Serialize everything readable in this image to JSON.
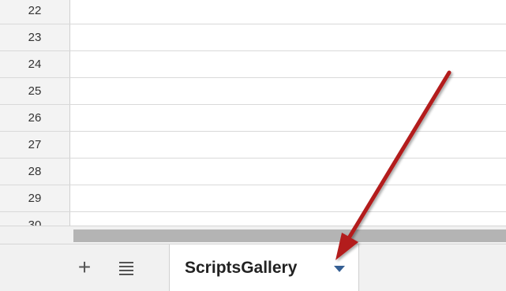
{
  "grid": {
    "rows": [
      {
        "number": "22"
      },
      {
        "number": "23"
      },
      {
        "number": "24"
      },
      {
        "number": "25"
      },
      {
        "number": "26"
      },
      {
        "number": "27"
      },
      {
        "number": "28"
      },
      {
        "number": "29"
      },
      {
        "number": "30"
      }
    ]
  },
  "sheet_bar": {
    "add_sheet_icon": "plus-icon",
    "all_sheets_icon": "list-icon",
    "active_tab": {
      "label": "ScriptsGallery",
      "caret_icon": "caret-down-icon",
      "caret_color": "#355f93"
    }
  },
  "annotation": {
    "arrow_color": "#b31b1b"
  }
}
